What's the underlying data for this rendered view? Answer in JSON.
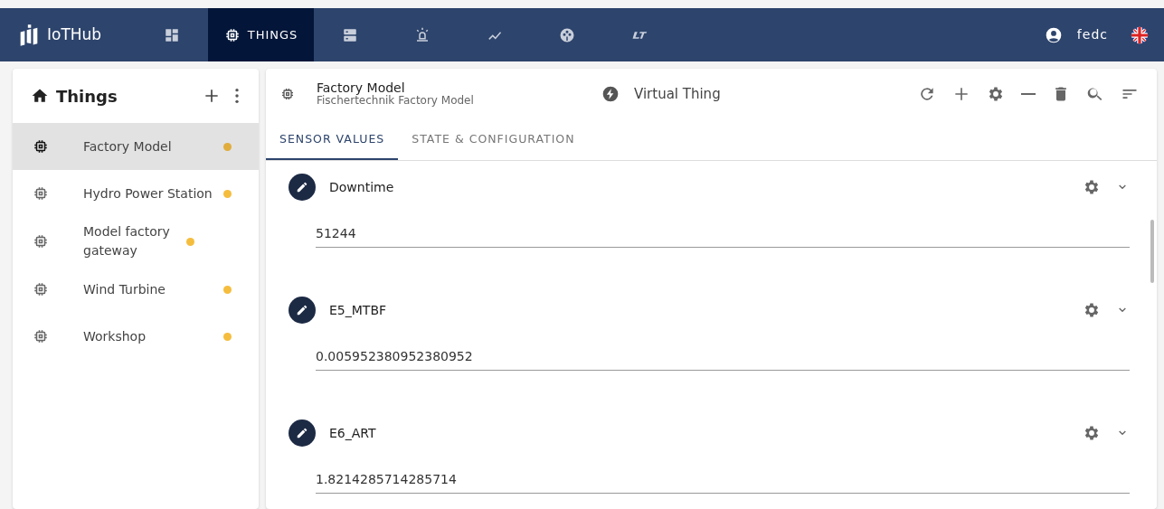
{
  "navbar": {
    "brand": "IoTHub",
    "items": [
      {
        "selected": false
      },
      {
        "label": "THINGS",
        "selected": true
      },
      {
        "selected": false
      },
      {
        "selected": false
      },
      {
        "selected": false
      },
      {
        "selected": false
      },
      {
        "selected": false
      }
    ],
    "user": "fedc"
  },
  "sidebar": {
    "title": "Things",
    "items": [
      {
        "name": "Factory Model",
        "selected": true,
        "color": "#e0ac3c"
      },
      {
        "name": "Hydro Power Station",
        "selected": false,
        "color": "#f5bd3e"
      },
      {
        "name": "Model factory gateway",
        "selected": false,
        "color": "#f5bd3e"
      },
      {
        "name": "Wind Turbine",
        "selected": false,
        "color": "#f5bd3e"
      },
      {
        "name": "Workshop",
        "selected": false,
        "color": "#f5bd3e"
      }
    ]
  },
  "thing": {
    "title": "Factory Model",
    "subtitle": "Fischertechnik Factory Model",
    "type": "Virtual Thing"
  },
  "tabs": [
    {
      "label": "SENSOR VALUES",
      "selected": true
    },
    {
      "label": "STATE & CONFIGURATION",
      "selected": false
    }
  ],
  "sensors": [
    {
      "name": "Downtime",
      "value": "51244"
    },
    {
      "name": "E5_MTBF",
      "value": "0.005952380952380952"
    },
    {
      "name": "E6_ART",
      "value": "1.8214285714285714"
    }
  ]
}
